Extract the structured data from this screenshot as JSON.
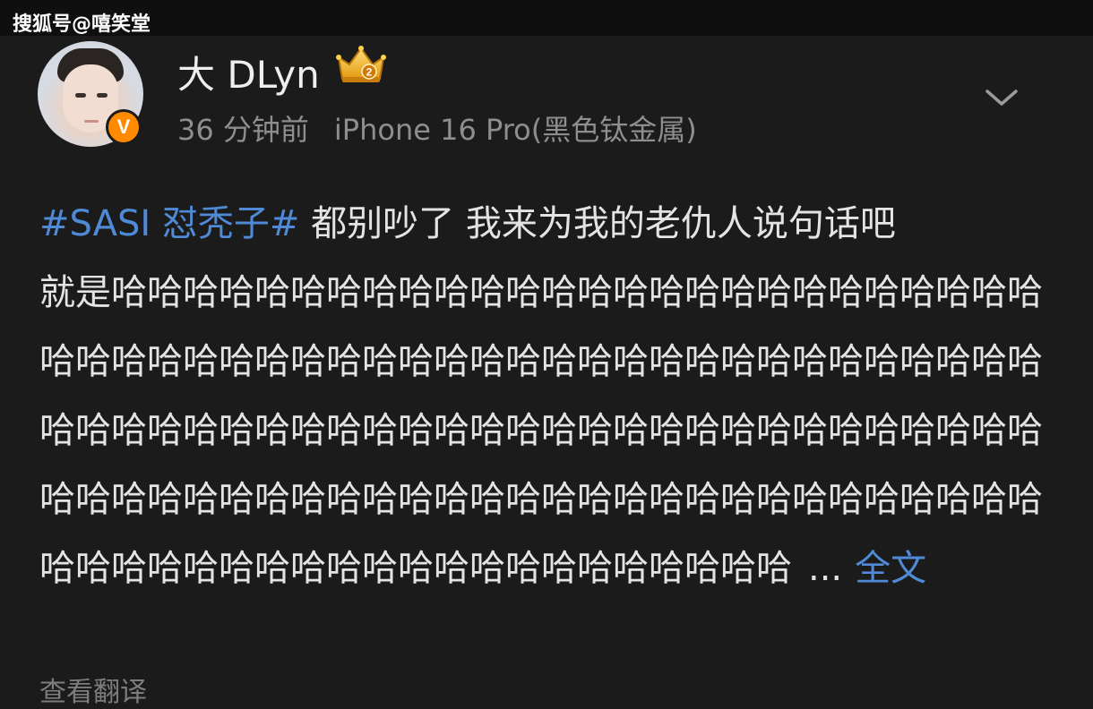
{
  "watermark": "搜狐号@嘻笑堂",
  "user": {
    "name": "大 DLyn",
    "verified_badge": "V",
    "crown_icon": "crown-level-2-icon",
    "crown_level": "2"
  },
  "meta": {
    "time": "36 分钟前",
    "source": "iPhone 16 Pro(黑色钛金属)"
  },
  "post": {
    "hashtag": "#SASI 怼秃子#",
    "line1_text": " 都别吵了 我来为我的老仇人说句话吧",
    "body": "就是哈哈哈哈哈哈哈哈哈哈哈哈哈哈哈哈哈哈哈哈哈哈哈哈哈哈哈哈哈哈哈哈哈哈哈哈哈哈哈哈哈哈哈哈哈哈哈哈哈哈哈哈哈哈哈哈哈哈哈哈哈哈哈哈哈哈哈哈哈哈哈哈哈哈哈哈哈哈哈哈哈哈哈哈哈哈哈哈哈哈哈哈哈哈哈哈哈哈哈哈哈哈哈哈哈哈哈哈哈哈哈哈哈哈哈哈哈哈哈哈哈哈哈哈哈哈哈哈哈哈哈",
    "ellipsis": "...",
    "full_text_link": "全文"
  },
  "translate_link": "查看翻译",
  "colors": {
    "background": "#1b1b1b",
    "link": "#4f8ad6",
    "badge": "#ff8a00"
  }
}
